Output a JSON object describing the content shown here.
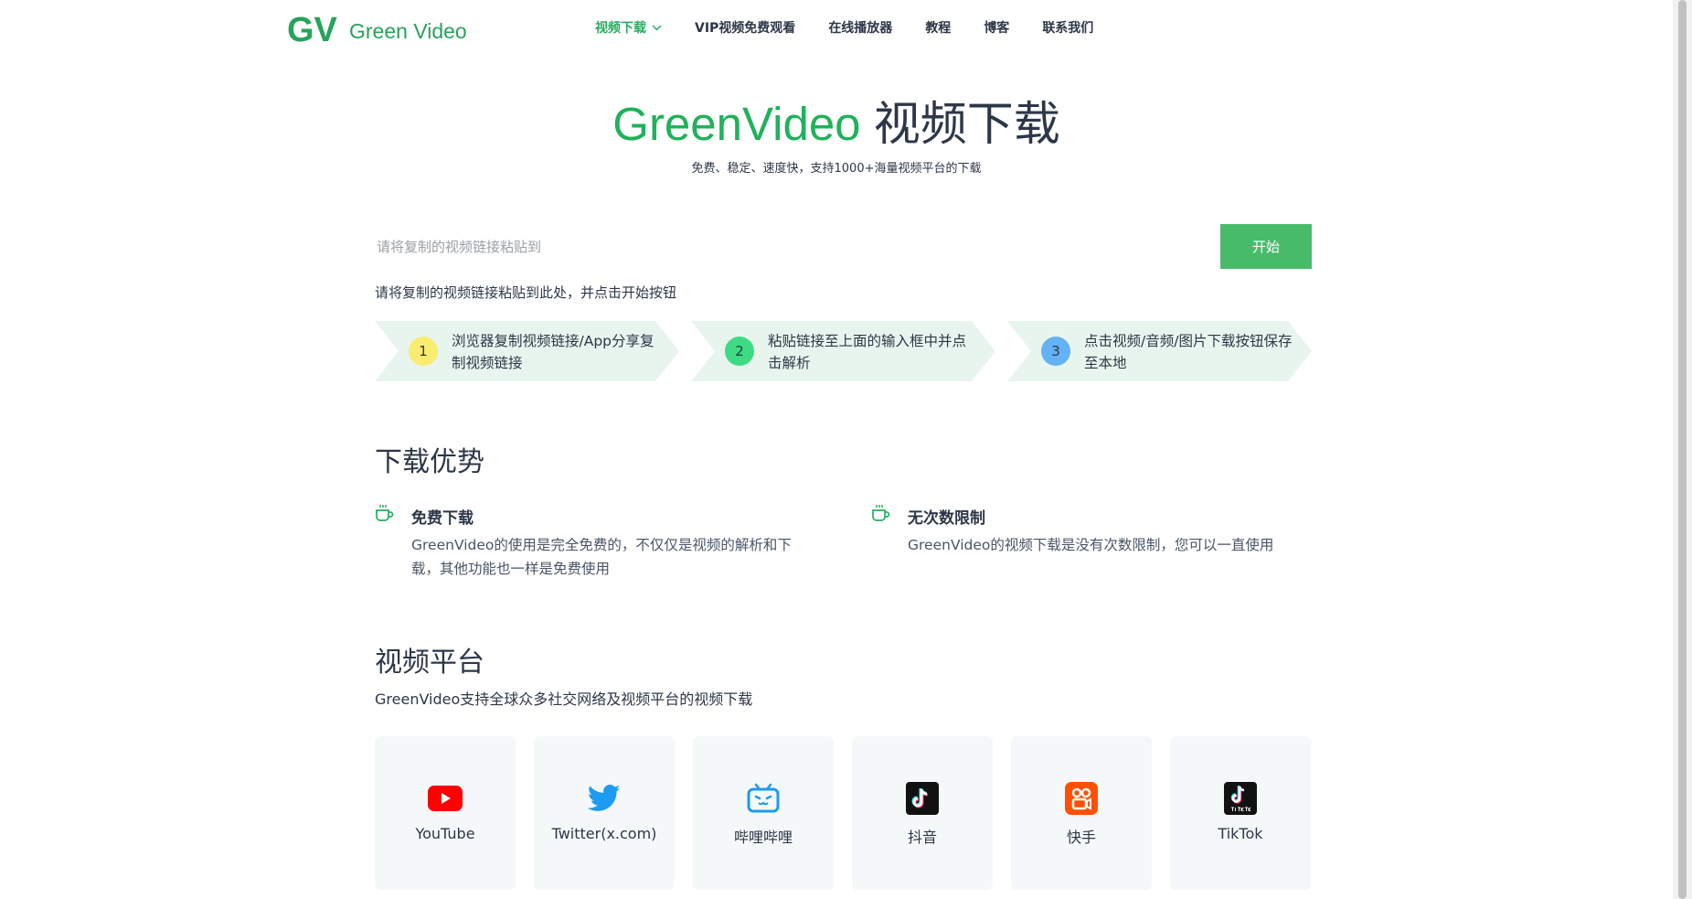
{
  "header": {
    "logo_text": "Green Video",
    "logo_mark_text": "GV",
    "nav": [
      {
        "label": "视频下载"
      },
      {
        "label": "VIP视频免费观看"
      },
      {
        "label": "在线播放器"
      },
      {
        "label": "教程"
      },
      {
        "label": "博客"
      },
      {
        "label": "联系我们"
      }
    ]
  },
  "hero": {
    "title_green": "GreenVideo",
    "title_dark": " 视频下载",
    "subtitle": "免费、稳定、速度快，支持1000+海量视频平台的下载"
  },
  "search": {
    "placeholder": "请将复制的视频链接粘贴到",
    "button_label": "开始",
    "hint": "请将复制的视频链接粘贴到此处，并点击开始按钮"
  },
  "steps": [
    {
      "num": "1",
      "text": "浏览器复制视频链接/App分享复制视频链接",
      "color": "#faec6e"
    },
    {
      "num": "2",
      "text": "粘贴链接至上面的输入框中并点击解析",
      "color": "#3ddc84"
    },
    {
      "num": "3",
      "text": "点击视频/音频/图片下载按钮保存至本地",
      "color": "#62b2f5"
    }
  ],
  "advantages": {
    "title": "下载优势",
    "items": [
      {
        "title": "免费下载",
        "desc": "GreenVideo的使用是完全免费的，不仅仅是视频的解析和下载，其他功能也一样是免费使用"
      },
      {
        "title": "无次数限制",
        "desc": "GreenVideo的视频下载是没有次数限制，您可以一直使用"
      }
    ]
  },
  "platforms": {
    "title": "视频平台",
    "desc": "GreenVideo支持全球众多社交网络及视频平台的视频下载",
    "items": [
      {
        "label": "YouTube",
        "icon": "youtube-icon"
      },
      {
        "label": "Twitter(x.com)",
        "icon": "twitter-icon"
      },
      {
        "label": "哔哩哔哩",
        "icon": "bilibili-icon"
      },
      {
        "label": "抖音",
        "icon": "douyin-icon"
      },
      {
        "label": "快手",
        "icon": "kuaishou-icon"
      },
      {
        "label": "TikTok",
        "icon": "tiktok-icon"
      }
    ]
  },
  "colors": {
    "brand_green": "#27ae60",
    "button_green": "#48bb6b",
    "step_bg": "#e8f5ee"
  }
}
